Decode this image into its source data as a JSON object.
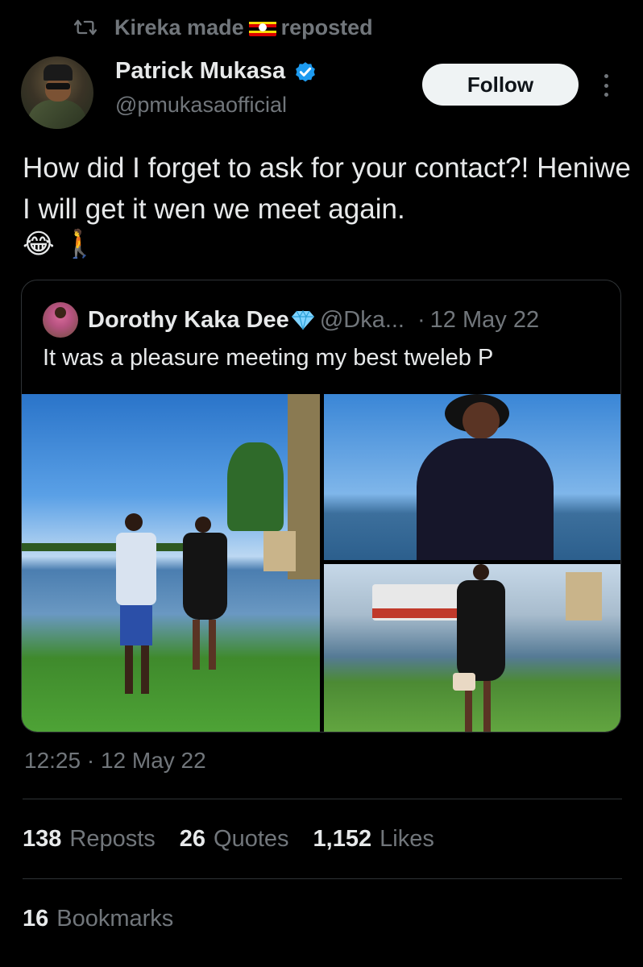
{
  "repost": {
    "icon": "repost-icon",
    "prefix": "Kireka made",
    "flag": "uganda-flag-icon",
    "suffix": "reposted"
  },
  "author": {
    "name": "Patrick Mukasa",
    "handle": "@pmukasaofficial",
    "verified": true
  },
  "follow_label": "Follow",
  "tweet": {
    "text": "How did I forget to ask for your contact?! Heniwe I will get it wen we meet again.",
    "emojis": [
      "😂",
      "🚶"
    ]
  },
  "quote": {
    "name": "Dorothy Kaka Dee",
    "handle": "@Dka...",
    "separator": "·",
    "date": "12 May 22",
    "text": "It was a pleasure meeting my best tweleb P"
  },
  "timestamp": "12:25 · 12 May 22",
  "stats": {
    "reposts_count": "138",
    "reposts_label": "Reposts",
    "quotes_count": "26",
    "quotes_label": "Quotes",
    "likes_count": "1,152",
    "likes_label": "Likes",
    "bookmarks_count": "16",
    "bookmarks_label": "Bookmarks"
  },
  "colors": {
    "background": "#000000",
    "text_primary": "#e7e9ea",
    "text_secondary": "#71767b",
    "verified_blue": "#1d9bf0",
    "border": "#2f3336"
  }
}
